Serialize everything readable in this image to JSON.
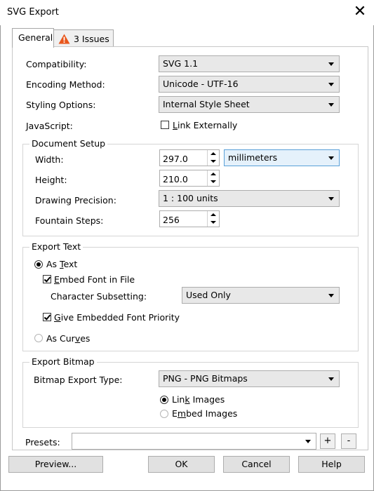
{
  "window": {
    "title": "SVG Export"
  },
  "tabs": [
    {
      "label": "General"
    },
    {
      "label": "3 Issues"
    }
  ],
  "general": {
    "compatibility": {
      "label": "Compatibility:",
      "value": "SVG 1.1"
    },
    "encoding": {
      "label": "Encoding Method:",
      "value": "Unicode - UTF-16"
    },
    "styling": {
      "label": "Styling Options:",
      "value": "Internal Style Sheet"
    },
    "javascript": {
      "label": "JavaScript:",
      "link_externally": {
        "pre": "",
        "key": "L",
        "post": "ink Externally",
        "checked": false
      }
    }
  },
  "document_setup": {
    "group_label": "Document Setup",
    "width": {
      "label": "Width:",
      "value": "297.0"
    },
    "units": {
      "value": "millimeters"
    },
    "height": {
      "label": "Height:",
      "value": "210.0"
    },
    "precision": {
      "label": "Drawing Precision:",
      "value": "1 : 100 units"
    },
    "fountain": {
      "label": "Fountain Steps:",
      "value": "256"
    }
  },
  "export_text": {
    "group_label": "Export Text",
    "as_text": {
      "pre": "As ",
      "key": "T",
      "post": "ext",
      "selected": true
    },
    "embed_font": {
      "pre": "",
      "key": "E",
      "post": "mbed Font in File",
      "checked": true
    },
    "subsetting": {
      "label": "Character Subsetting:",
      "value": "Used Only"
    },
    "give_priority": {
      "pre": "",
      "key": "G",
      "post": "ive Embedded Font Priority",
      "checked": true
    },
    "as_curves": {
      "pre": "As Cur",
      "key": "v",
      "post": "es",
      "selected": false
    }
  },
  "export_bitmap": {
    "group_label": "Export Bitmap",
    "type": {
      "label": "Bitmap Export Type:",
      "value": "PNG - PNG Bitmaps"
    },
    "link_images": {
      "pre": "Lin",
      "key": "k",
      "post": " Images",
      "selected": true
    },
    "embed_images": {
      "pre": "E",
      "key": "m",
      "post": "bed Images",
      "selected": false
    }
  },
  "presets": {
    "label": "Presets:",
    "value": "",
    "add": "+",
    "remove": "-"
  },
  "buttons": {
    "preview": "Preview...",
    "ok": "OK",
    "cancel": "Cancel",
    "help": "Help"
  },
  "colors": {
    "warning": "#e8561c",
    "focus": "#5aa0d8"
  }
}
